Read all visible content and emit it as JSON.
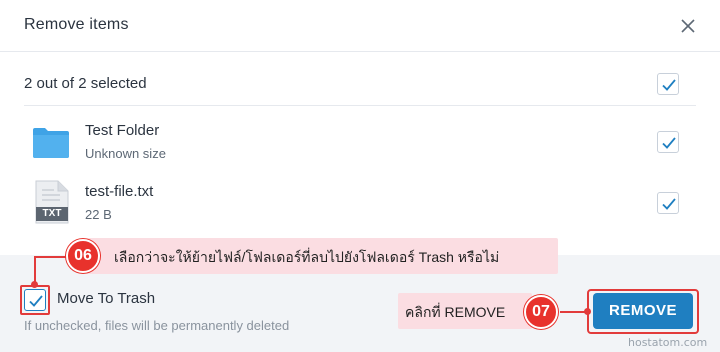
{
  "dialog": {
    "title": "Remove items",
    "close_icon": "close-icon"
  },
  "summary": {
    "text": "2 out of 2 selected",
    "checked": true
  },
  "items": [
    {
      "name": "Test Folder",
      "detail": "Unknown size",
      "icon": "folder-icon",
      "checked": true
    },
    {
      "name": "test-file.txt",
      "detail": "22 B",
      "icon": "txt-file-icon",
      "file_badge": "TXT",
      "checked": true
    }
  ],
  "footer": {
    "move_to_trash_label": "Move To Trash",
    "move_to_trash_checked": true,
    "hint": "If unchecked, files will be permanently deleted",
    "remove_label": "REMOVE"
  },
  "annotations": [
    {
      "number": "06",
      "text": "เลือกว่าจะให้ย้ายไฟล์/โฟลเดอร์ที่ลบไปยังโฟลเดอร์ Trash หรือไม่"
    },
    {
      "number": "07",
      "text": "คลิกที่ REMOVE"
    }
  ],
  "watermark": "hostatom.com",
  "colors": {
    "accent": "#1f7fc1",
    "annotation_red": "#e23b3b",
    "callout_bg": "#fbdde2",
    "folder": "#3fa3e6"
  }
}
